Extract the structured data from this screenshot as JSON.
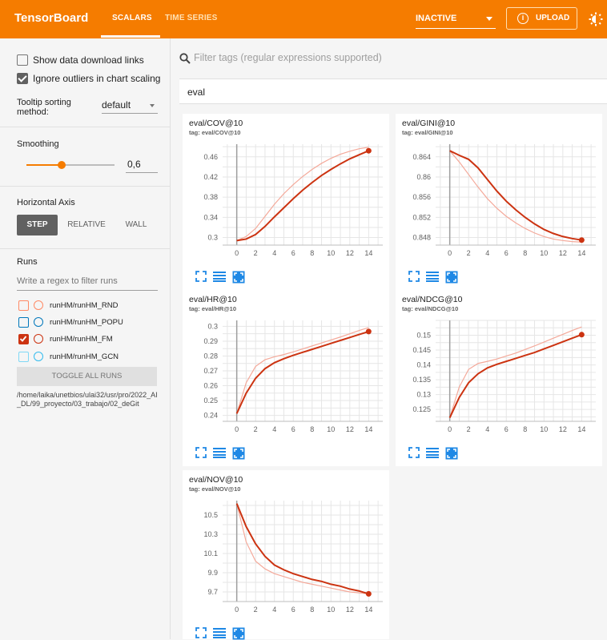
{
  "app": {
    "title": "TensorBoard"
  },
  "nav": {
    "tabs": [
      {
        "label": "SCALARS"
      },
      {
        "label": "TIME SERIES"
      }
    ]
  },
  "header": {
    "status_select": "INACTIVE",
    "upload_label": "UPLOAD"
  },
  "sidebar": {
    "show_download_label": "Show data download links",
    "show_download_checked": false,
    "ignore_outliers_label": "Ignore outliers in chart scaling",
    "ignore_outliers_checked": true,
    "tooltip_label_1": "Tooltip sorting",
    "tooltip_label_2": "method:",
    "tooltip_value": "default",
    "smoothing_label": "Smoothing",
    "smoothing_value": "0,6",
    "smoothing_fraction": 0.6,
    "horizontal_axis_label": "Horizontal Axis",
    "axis_options": [
      {
        "label": "STEP"
      },
      {
        "label": "RELATIVE"
      },
      {
        "label": "WALL"
      }
    ],
    "runs_label": "Runs",
    "runs_filter_placeholder": "Write a regex to filter runs",
    "runs": [
      {
        "label": "runHM/runHM_RND",
        "color": "#ff7043",
        "checked": false
      },
      {
        "label": "runHM/runHM_POPU",
        "color": "#0077bb",
        "checked": false
      },
      {
        "label": "runHM/runHM_FM",
        "color": "#cc3311",
        "checked": true
      },
      {
        "label": "runHM/runHM_GCN",
        "color": "#33bbee",
        "checked": false
      }
    ],
    "toggle_all_label": "TOGGLE ALL RUNS",
    "logdir": "/home/laika/unetbios/ulai32/usr/pro/2022_AI_DL/99_proyecto/03_trabajo/02_deGit"
  },
  "main": {
    "filter_placeholder": "Filter tags (regular expressions supported)",
    "group_name": "eval"
  },
  "colors": {
    "accent": "#f57c00",
    "series": "#cc3311",
    "series_raw": "#f4a99a"
  },
  "chart_data": [
    {
      "type": "line",
      "title": "eval/COV@10",
      "tag": "tag: eval/COV@10",
      "xticks": [
        0,
        2,
        4,
        6,
        8,
        10,
        12,
        14
      ],
      "yticks": [
        "0.3",
        "0.34",
        "0.38",
        "0.42",
        "0.46"
      ],
      "xlim": [
        -1.5,
        15.5
      ],
      "ylim": [
        0.285,
        0.485
      ],
      "series": [
        {
          "x": [
            0,
            1,
            2,
            3,
            4,
            5,
            6,
            7,
            8,
            9,
            10,
            11,
            12,
            13,
            14
          ],
          "y": [
            0.294,
            0.297,
            0.306,
            0.322,
            0.341,
            0.359,
            0.377,
            0.394,
            0.409,
            0.423,
            0.435,
            0.446,
            0.456,
            0.464,
            0.472
          ]
        }
      ],
      "raw": [
        {
          "x": [
            0,
            1,
            2,
            3,
            4,
            5,
            6,
            7,
            8,
            9,
            10,
            11,
            12,
            13,
            14
          ],
          "y": [
            0.294,
            0.302,
            0.318,
            0.342,
            0.366,
            0.387,
            0.405,
            0.421,
            0.435,
            0.447,
            0.457,
            0.465,
            0.471,
            0.476,
            0.479
          ]
        }
      ]
    },
    {
      "type": "line",
      "title": "eval/GINI@10",
      "tag": "tag: eval/GINI@10",
      "xticks": [
        0,
        2,
        4,
        6,
        8,
        10,
        12,
        14
      ],
      "yticks": [
        "0.848",
        "0.852",
        "0.856",
        "0.86",
        "0.864"
      ],
      "xlim": [
        -1.5,
        15.5
      ],
      "ylim": [
        0.8465,
        0.8665
      ],
      "series": [
        {
          "x": [
            0,
            1,
            2,
            3,
            4,
            5,
            6,
            7,
            8,
            9,
            10,
            11,
            12,
            13,
            14
          ],
          "y": [
            0.8652,
            0.8643,
            0.8635,
            0.8618,
            0.8595,
            0.8572,
            0.8552,
            0.8535,
            0.852,
            0.8507,
            0.8496,
            0.8488,
            0.8482,
            0.8478,
            0.8475
          ]
        }
      ],
      "raw": [
        {
          "x": [
            0,
            1,
            2,
            3,
            4,
            5,
            6,
            7,
            8,
            9,
            10,
            11,
            12,
            13,
            14
          ],
          "y": [
            0.8652,
            0.863,
            0.8605,
            0.858,
            0.8557,
            0.8538,
            0.8522,
            0.8509,
            0.8498,
            0.8489,
            0.8482,
            0.8477,
            0.8474,
            0.8472,
            0.8471
          ]
        }
      ]
    },
    {
      "type": "line",
      "title": "eval/HR@10",
      "tag": "tag: eval/HR@10",
      "xticks": [
        0,
        2,
        4,
        6,
        8,
        10,
        12,
        14
      ],
      "yticks": [
        "0.24",
        "0.25",
        "0.26",
        "0.27",
        "0.28",
        "0.29",
        "0.3"
      ],
      "xlim": [
        -1.5,
        15.5
      ],
      "ylim": [
        0.236,
        0.304
      ],
      "series": [
        {
          "x": [
            0,
            1,
            2,
            3,
            4,
            5,
            6,
            7,
            8,
            9,
            10,
            11,
            12,
            13,
            14
          ],
          "y": [
            0.2412,
            0.255,
            0.265,
            0.2715,
            0.2755,
            0.2782,
            0.2805,
            0.2825,
            0.2845,
            0.2865,
            0.2885,
            0.2905,
            0.2925,
            0.2945,
            0.2965
          ]
        }
      ],
      "raw": [
        {
          "x": [
            0,
            1,
            2,
            3,
            4,
            5,
            6,
            7,
            8,
            9,
            10,
            11,
            12,
            13,
            14
          ],
          "y": [
            0.2412,
            0.262,
            0.273,
            0.2775,
            0.2795,
            0.281,
            0.2828,
            0.2848,
            0.2868,
            0.2888,
            0.2908,
            0.2928,
            0.295,
            0.2972,
            0.2992
          ]
        }
      ]
    },
    {
      "type": "line",
      "title": "eval/NDCG@10",
      "tag": "tag: eval/NDCG@10",
      "xticks": [
        0,
        2,
        4,
        6,
        8,
        10,
        12,
        14
      ],
      "yticks": [
        "0.125",
        "0.13",
        "0.135",
        "0.14",
        "0.145",
        "0.15"
      ],
      "xlim": [
        -1.5,
        15.5
      ],
      "ylim": [
        0.121,
        0.155
      ],
      "series": [
        {
          "x": [
            0,
            1,
            2,
            3,
            4,
            5,
            6,
            7,
            8,
            9,
            10,
            11,
            12,
            13,
            14
          ],
          "y": [
            0.1222,
            0.129,
            0.134,
            0.137,
            0.139,
            0.1402,
            0.1412,
            0.1422,
            0.1432,
            0.1442,
            0.1454,
            0.1466,
            0.1478,
            0.149,
            0.1502
          ]
        }
      ],
      "raw": [
        {
          "x": [
            0,
            1,
            2,
            3,
            4,
            5,
            6,
            7,
            8,
            9,
            10,
            11,
            12,
            13,
            14
          ],
          "y": [
            0.1222,
            0.1325,
            0.1385,
            0.1405,
            0.1412,
            0.142,
            0.143,
            0.144,
            0.1452,
            0.1464,
            0.1477,
            0.149,
            0.1503,
            0.1516,
            0.1528
          ]
        }
      ]
    },
    {
      "type": "line",
      "title": "eval/NOV@10",
      "tag": "tag: eval/NOV@10",
      "xticks": [
        0,
        2,
        4,
        6,
        8,
        10,
        12,
        14
      ],
      "yticks": [
        "9.7",
        "9.9",
        "10.1",
        "10.3",
        "10.5"
      ],
      "xlim": [
        -1.5,
        15.5
      ],
      "ylim": [
        9.6,
        10.65
      ],
      "series": [
        {
          "x": [
            0,
            1,
            2,
            3,
            4,
            5,
            6,
            7,
            8,
            9,
            10,
            11,
            12,
            13,
            14
          ],
          "y": [
            10.62,
            10.38,
            10.2,
            10.07,
            9.98,
            9.93,
            9.89,
            9.86,
            9.83,
            9.81,
            9.78,
            9.76,
            9.73,
            9.71,
            9.68
          ]
        }
      ],
      "raw": [
        {
          "x": [
            0,
            1,
            2,
            3,
            4,
            5,
            6,
            7,
            8,
            9,
            10,
            11,
            12,
            13,
            14
          ],
          "y": [
            10.62,
            10.22,
            10.02,
            9.94,
            9.89,
            9.86,
            9.83,
            9.8,
            9.78,
            9.76,
            9.74,
            9.72,
            9.7,
            9.69,
            9.68
          ]
        }
      ]
    }
  ]
}
